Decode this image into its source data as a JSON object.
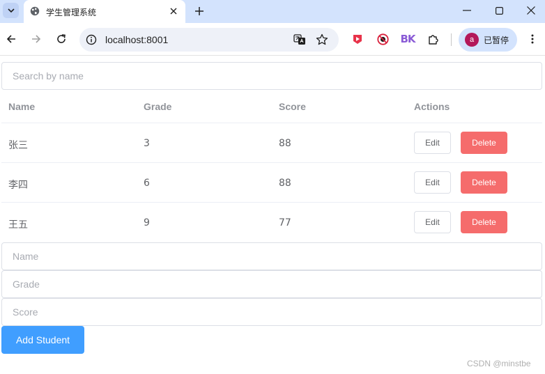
{
  "browser": {
    "tab_title": "学生管理系统",
    "url": "localhost:8001",
    "profile_initial": "a",
    "profile_label": "已暂停",
    "extension_bk_label": "BK"
  },
  "search": {
    "placeholder": "Search by name"
  },
  "table": {
    "headers": [
      "Name",
      "Grade",
      "Score",
      "Actions"
    ],
    "rows": [
      {
        "name": "张三",
        "grade": "3",
        "score": "88"
      },
      {
        "name": "李四",
        "grade": "6",
        "score": "88"
      },
      {
        "name": "王五",
        "grade": "9",
        "score": "77"
      }
    ],
    "edit_label": "Edit",
    "delete_label": "Delete"
  },
  "form": {
    "name_placeholder": "Name",
    "grade_placeholder": "Grade",
    "score_placeholder": "Score",
    "add_label": "Add Student"
  },
  "watermark": "CSDN @minstbe",
  "colors": {
    "primary": "#409eff",
    "danger": "#f56c6c",
    "chrome_tabstrip": "#d3e3fd"
  }
}
